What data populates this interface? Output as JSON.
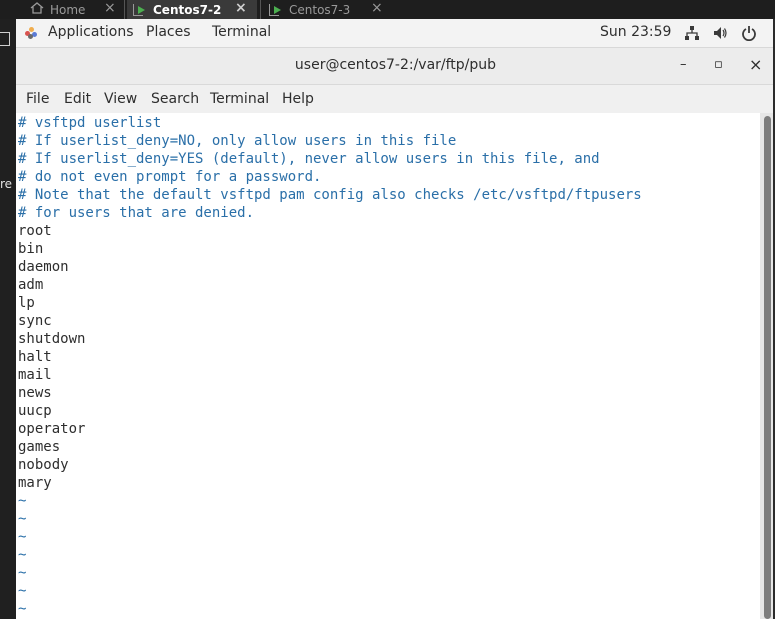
{
  "vm_tabs": [
    {
      "label": "Home",
      "active": false
    },
    {
      "label": "Centos7-2",
      "active": true
    },
    {
      "label": "Centos7-3",
      "active": false
    }
  ],
  "tab_close_glyph": "×",
  "host": {
    "fragment": "re"
  },
  "topbar": {
    "applications": "Applications",
    "places": "Places",
    "terminal": "Terminal",
    "clock": "Sun 23:59"
  },
  "window": {
    "title": "user@centos7-2:/var/ftp/pub",
    "minimize": "–",
    "maximize": "▫",
    "close": "×"
  },
  "menu": [
    "File",
    "Edit",
    "View",
    "Search",
    "Terminal",
    "Help"
  ],
  "terminal": {
    "comments": [
      "# vsftpd userlist",
      "# If userlist_deny=NO, only allow users in this file",
      "# If userlist_deny=YES (default), never allow users in this file, and",
      "# do not even prompt for a password.",
      "# Note that the default vsftpd pam config also checks /etc/vsftpd/ftpusers",
      "# for users that are denied."
    ],
    "users": [
      "root",
      "bin",
      "daemon",
      "adm",
      "lp",
      "sync",
      "shutdown",
      "halt",
      "mail",
      "news",
      "uucp",
      "operator",
      "games",
      "nobody",
      "mary"
    ],
    "tildes": [
      "~",
      "~",
      "~",
      "~",
      "~",
      "~",
      "~"
    ]
  },
  "colors": {
    "comment": "#2a6fa8",
    "accent_play": "#4caf50",
    "terminal_bg": "#ffffff",
    "topbar_bg": "#f3f3f3"
  },
  "icons": [
    "home-icon",
    "vm-icon",
    "apps-icon",
    "network-icon",
    "volume-icon",
    "power-icon"
  ]
}
